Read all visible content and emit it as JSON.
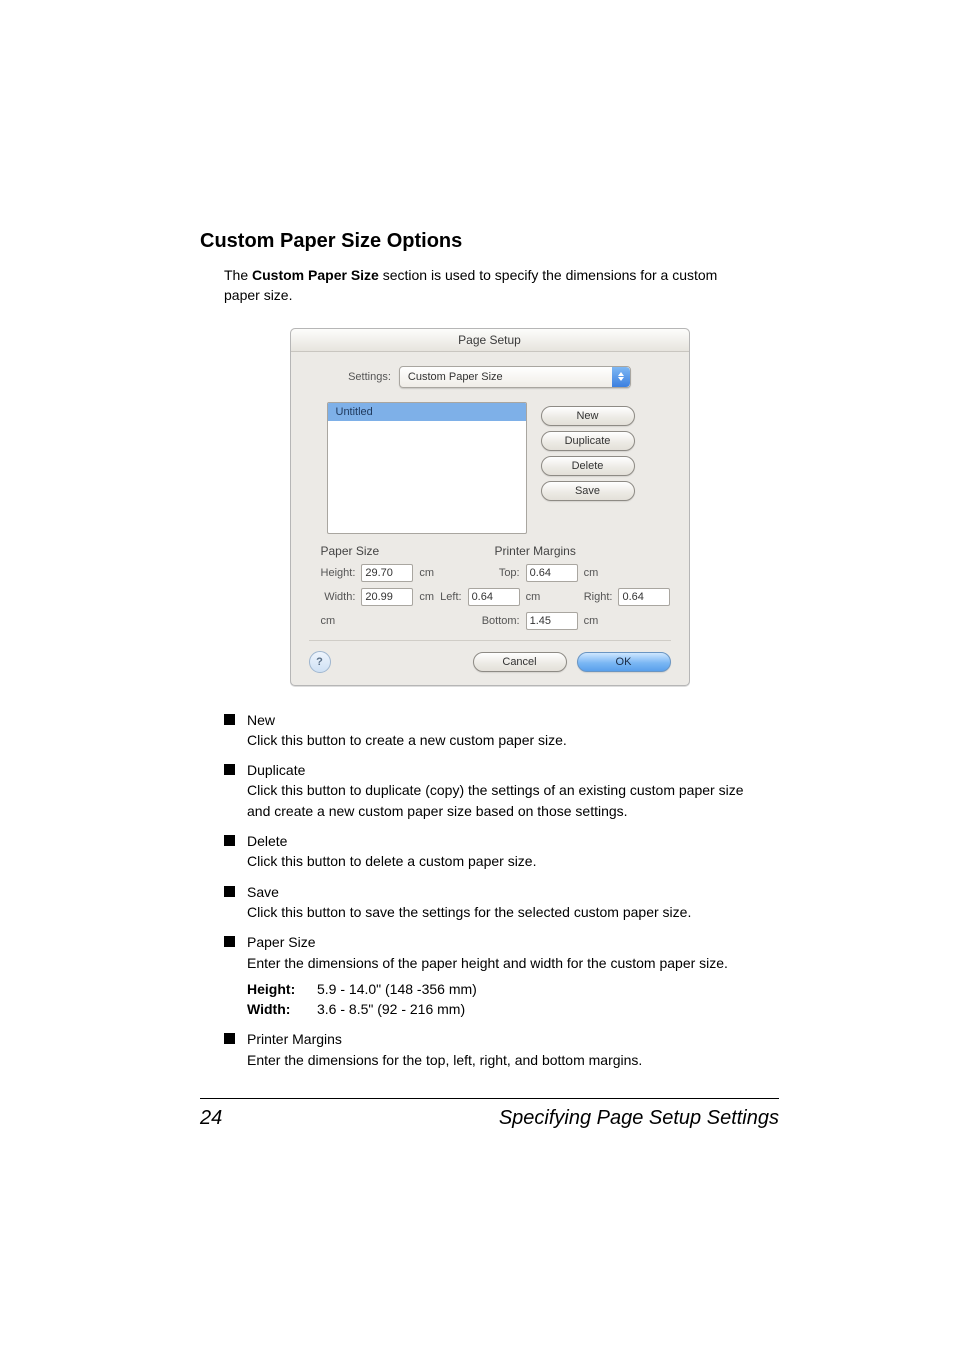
{
  "heading": "Custom Paper Size Options",
  "intro_prefix": "The ",
  "intro_bold": "Custom Paper Size",
  "intro_suffix": " section is used to specify the dimensions for a custom paper size.",
  "dialog": {
    "title": "Page Setup",
    "settings_label": "Settings:",
    "settings_value": "Custom Paper Size",
    "list_item": "Untitled",
    "btn_new": "New",
    "btn_duplicate": "Duplicate",
    "btn_delete": "Delete",
    "btn_save": "Save",
    "paper_size_hdr": "Paper Size",
    "printer_margins_hdr": "Printer Margins",
    "height_label": "Height:",
    "height_value": "29.70",
    "width_label": "Width:",
    "width_value": "20.99",
    "top_label": "Top:",
    "top_value": "0.64",
    "left_label": "Left:",
    "left_value": "0.64",
    "right_label": "Right:",
    "right_value": "0.64",
    "bottom_label": "Bottom:",
    "bottom_value": "1.45",
    "unit": "cm",
    "help_glyph": "?",
    "cancel": "Cancel",
    "ok": "OK"
  },
  "bullets": {
    "new_t": "New",
    "new_d": "Click this button to create a new custom paper size.",
    "dup_t": "Duplicate",
    "dup_d": "Click this button to duplicate (copy) the settings of an existing custom paper size and create a new custom paper size based on those settings.",
    "del_t": "Delete",
    "del_d": "Click this button to delete a custom paper size.",
    "save_t": "Save",
    "save_d": "Click this button to save the settings for the selected custom paper size.",
    "ps_t": "Paper Size",
    "ps_d": "Enter the dimensions of the paper height and width for the custom paper size.",
    "h_k": "Height",
    "h_colon": ":",
    "h_v": "5.9 - 14.0\" (148 -356 mm)",
    "w_k": "Width",
    "w_colon": ":",
    "w_v": "3.6 - 8.5\" (92 - 216 mm)",
    "pm_t": "Printer Margins",
    "pm_d": "Enter the dimensions for the top, left, right, and bottom margins."
  },
  "footer": {
    "page_number": "24",
    "section_title": "Specifying Page Setup Settings"
  }
}
